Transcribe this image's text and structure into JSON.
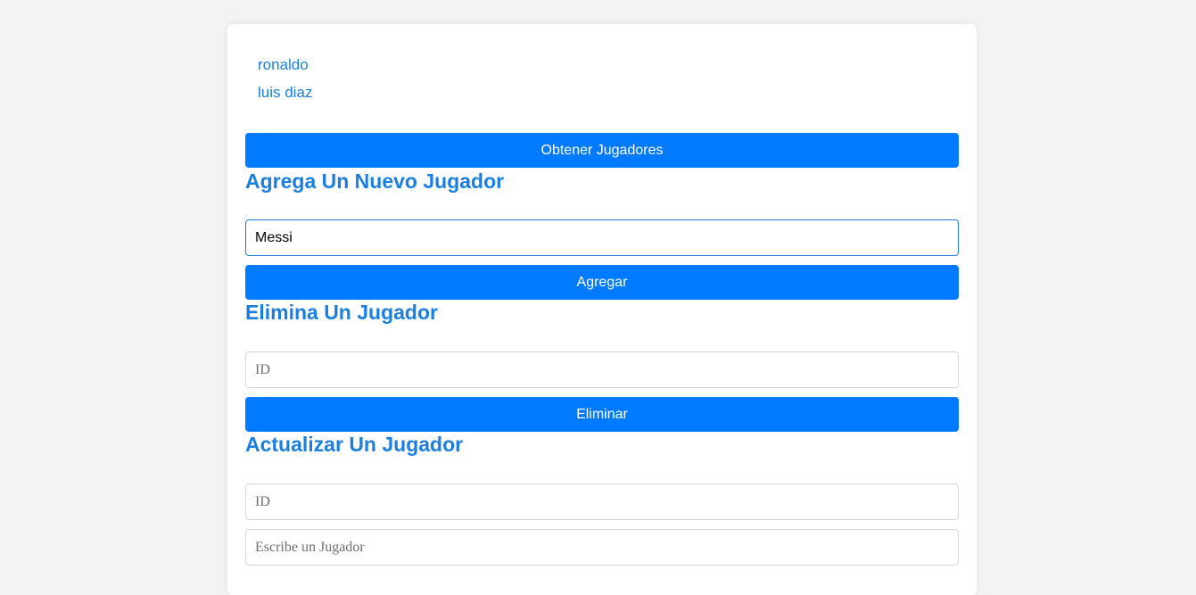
{
  "players": [
    "ronaldo",
    "luis diaz"
  ],
  "get_section": {
    "button_label": "Obtener Jugadores"
  },
  "add_section": {
    "heading": "Agrega Un Nuevo Jugador",
    "input_value": "Messi",
    "button_label": "Agregar"
  },
  "delete_section": {
    "heading": "Elimina Un Jugador",
    "id_placeholder": "ID",
    "button_label": "Eliminar"
  },
  "update_section": {
    "heading": "Actualizar Un Jugador",
    "id_placeholder": "ID",
    "name_placeholder": "Escribe un Jugador"
  },
  "colors": {
    "accent": "#007bff",
    "heading": "#1a7fe0",
    "background": "#f3f3f3"
  }
}
